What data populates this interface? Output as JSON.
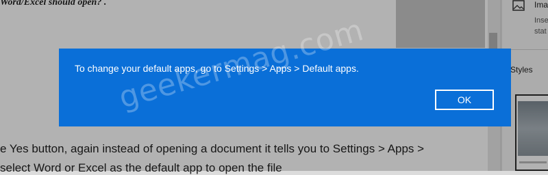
{
  "document": {
    "top_fragment": "Word/Excel should open? .",
    "line1": "e Yes button, again instead of opening a document it tells you to Settings > Apps >",
    "line2": "select Word or Excel as the default app to open the file"
  },
  "right_pane": {
    "image_label": "Ima",
    "image_desc_line1": "Inse",
    "image_desc_line2": "stat",
    "styles_label": "Styles",
    "image_icon": "image-icon"
  },
  "dialog": {
    "message": "To change your default apps, go to Settings > Apps > Default apps.",
    "ok_label": "OK",
    "background": "#0a6fd8"
  },
  "watermark": "geekermag.com"
}
